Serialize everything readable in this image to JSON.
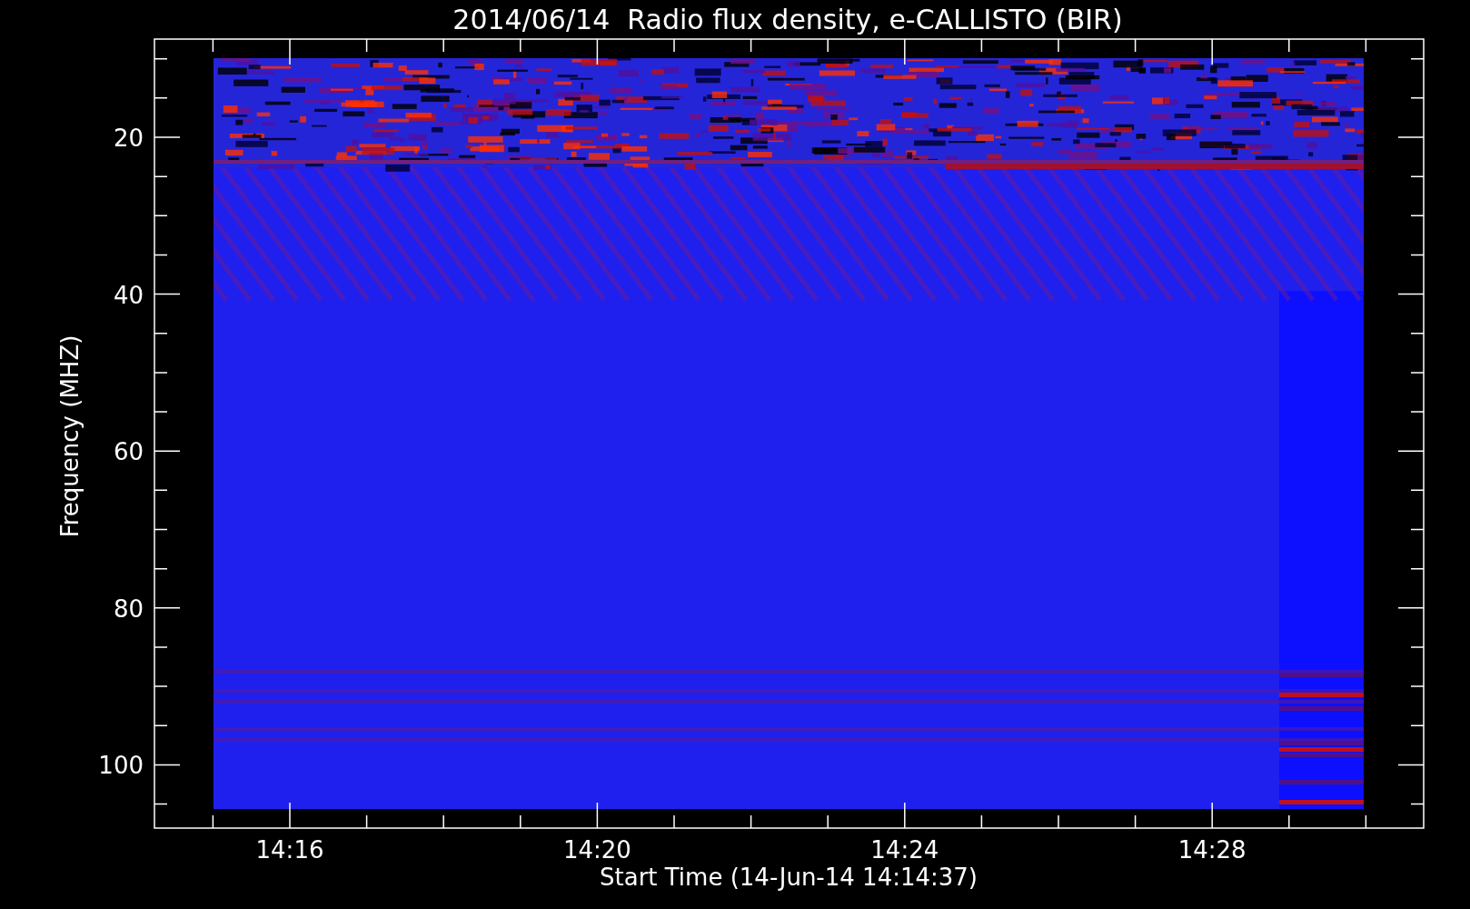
{
  "plot": {
    "title": "2014/06/14  Radio flux density, e-CALLISTO (BIR)",
    "ylabel": "Frequency (MHZ)",
    "xlabel": "Start Time (14-Jun-14 14:14:37)",
    "yticks": [
      "20",
      "40",
      "60",
      "80",
      "100"
    ],
    "xticks": [
      "14:16",
      "14:20",
      "14:24",
      "14:28"
    ]
  }
}
